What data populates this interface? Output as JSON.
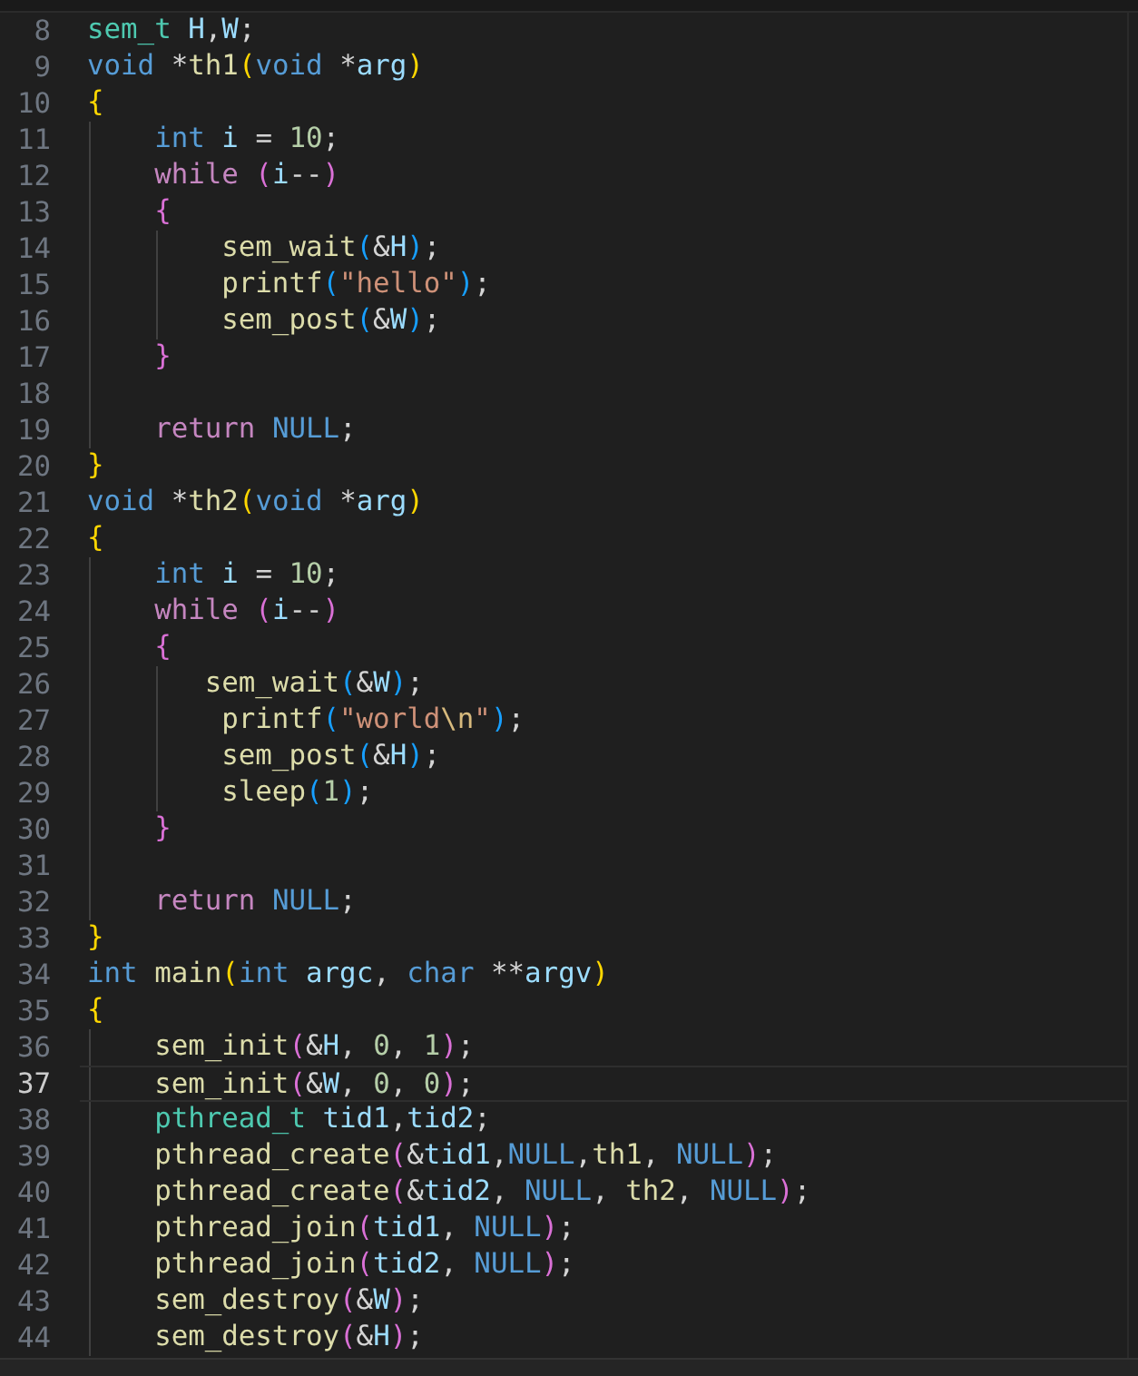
{
  "editor": {
    "lines": [
      {
        "number": "8",
        "active": false,
        "tokens": [
          {
            "text": "sem_t",
            "kind": "type"
          },
          {
            "text": " H",
            "kind": "var"
          },
          {
            "text": ",",
            "kind": "p"
          },
          {
            "text": "W",
            "kind": "var"
          },
          {
            "text": ";",
            "kind": "p"
          }
        ]
      },
      {
        "number": "9",
        "active": false,
        "tokens": [
          {
            "text": "void",
            "kind": "kw"
          },
          {
            "text": " *",
            "kind": "p"
          },
          {
            "text": "th1",
            "kind": "fn"
          },
          {
            "text": "(",
            "kind": "b1"
          },
          {
            "text": "void",
            "kind": "kw"
          },
          {
            "text": " *",
            "kind": "p"
          },
          {
            "text": "arg",
            "kind": "var"
          },
          {
            "text": ")",
            "kind": "b1"
          }
        ]
      },
      {
        "number": "10",
        "active": false,
        "tokens": [
          {
            "text": "{",
            "kind": "b1"
          }
        ]
      },
      {
        "number": "11",
        "active": false,
        "tokens": [
          {
            "text": "    int",
            "kind": "kw"
          },
          {
            "text": " i",
            "kind": "var"
          },
          {
            "text": " = ",
            "kind": "p"
          },
          {
            "text": "10",
            "kind": "num"
          },
          {
            "text": ";",
            "kind": "p"
          }
        ]
      },
      {
        "number": "12",
        "active": false,
        "tokens": [
          {
            "text": "    while",
            "kind": "ctl"
          },
          {
            "text": " (",
            "kind": "b2"
          },
          {
            "text": "i",
            "kind": "var"
          },
          {
            "text": "--",
            "kind": "p"
          },
          {
            "text": ")",
            "kind": "b2"
          }
        ]
      },
      {
        "number": "13",
        "active": false,
        "tokens": [
          {
            "text": "    {",
            "kind": "b2"
          }
        ]
      },
      {
        "number": "14",
        "active": false,
        "tokens": [
          {
            "text": "        sem_wait",
            "kind": "fn"
          },
          {
            "text": "(",
            "kind": "b3"
          },
          {
            "text": "&",
            "kind": "p"
          },
          {
            "text": "H",
            "kind": "var"
          },
          {
            "text": ")",
            "kind": "b3"
          },
          {
            "text": ";",
            "kind": "p"
          }
        ]
      },
      {
        "number": "15",
        "active": false,
        "tokens": [
          {
            "text": "        printf",
            "kind": "fn"
          },
          {
            "text": "(",
            "kind": "b3"
          },
          {
            "text": "\"hello\"",
            "kind": "str"
          },
          {
            "text": ")",
            "kind": "b3"
          },
          {
            "text": ";",
            "kind": "p"
          }
        ]
      },
      {
        "number": "16",
        "active": false,
        "tokens": [
          {
            "text": "        sem_post",
            "kind": "fn"
          },
          {
            "text": "(",
            "kind": "b3"
          },
          {
            "text": "&",
            "kind": "p"
          },
          {
            "text": "W",
            "kind": "var"
          },
          {
            "text": ")",
            "kind": "b3"
          },
          {
            "text": ";",
            "kind": "p"
          }
        ]
      },
      {
        "number": "17",
        "active": false,
        "tokens": [
          {
            "text": "    }",
            "kind": "b2"
          }
        ]
      },
      {
        "number": "18",
        "active": false
      },
      {
        "number": "19",
        "active": false,
        "tokens": [
          {
            "text": "    return",
            "kind": "ctl"
          },
          {
            "text": " NULL",
            "kind": "kw"
          },
          {
            "text": ";",
            "kind": "p"
          }
        ]
      },
      {
        "number": "20",
        "active": false,
        "tokens": [
          {
            "text": "}",
            "kind": "b1"
          }
        ]
      },
      {
        "number": "21",
        "active": false,
        "tokens": [
          {
            "text": "void",
            "kind": "kw"
          },
          {
            "text": " *",
            "kind": "p"
          },
          {
            "text": "th2",
            "kind": "fn"
          },
          {
            "text": "(",
            "kind": "b1"
          },
          {
            "text": "void",
            "kind": "kw"
          },
          {
            "text": " *",
            "kind": "p"
          },
          {
            "text": "arg",
            "kind": "var"
          },
          {
            "text": ")",
            "kind": "b1"
          }
        ]
      },
      {
        "number": "22",
        "active": false,
        "tokens": [
          {
            "text": "{",
            "kind": "b1"
          }
        ]
      },
      {
        "number": "23",
        "active": false,
        "tokens": [
          {
            "text": "    int",
            "kind": "kw"
          },
          {
            "text": " i",
            "kind": "var"
          },
          {
            "text": " = ",
            "kind": "p"
          },
          {
            "text": "10",
            "kind": "num"
          },
          {
            "text": ";",
            "kind": "p"
          }
        ]
      },
      {
        "number": "24",
        "active": false,
        "tokens": [
          {
            "text": "    while",
            "kind": "ctl"
          },
          {
            "text": " (",
            "kind": "b2"
          },
          {
            "text": "i",
            "kind": "var"
          },
          {
            "text": "--",
            "kind": "p"
          },
          {
            "text": ")",
            "kind": "b2"
          }
        ]
      },
      {
        "number": "25",
        "active": false,
        "tokens": [
          {
            "text": "    {",
            "kind": "b2"
          }
        ]
      },
      {
        "number": "26",
        "active": false,
        "tokens": [
          {
            "text": "       sem_wait",
            "kind": "fn"
          },
          {
            "text": "(",
            "kind": "b3"
          },
          {
            "text": "&",
            "kind": "p"
          },
          {
            "text": "W",
            "kind": "var"
          },
          {
            "text": ")",
            "kind": "b3"
          },
          {
            "text": ";",
            "kind": "p"
          }
        ]
      },
      {
        "number": "27",
        "active": false,
        "tokens": [
          {
            "text": "        printf",
            "kind": "fn"
          },
          {
            "text": "(",
            "kind": "b3"
          },
          {
            "text": "\"world",
            "kind": "str"
          },
          {
            "text": "\\n",
            "kind": "esc"
          },
          {
            "text": "\"",
            "kind": "str"
          },
          {
            "text": ")",
            "kind": "b3"
          },
          {
            "text": ";",
            "kind": "p"
          }
        ]
      },
      {
        "number": "28",
        "active": false,
        "tokens": [
          {
            "text": "        sem_post",
            "kind": "fn"
          },
          {
            "text": "(",
            "kind": "b3"
          },
          {
            "text": "&",
            "kind": "p"
          },
          {
            "text": "H",
            "kind": "var"
          },
          {
            "text": ")",
            "kind": "b3"
          },
          {
            "text": ";",
            "kind": "p"
          }
        ]
      },
      {
        "number": "29",
        "active": false,
        "tokens": [
          {
            "text": "        sleep",
            "kind": "fn"
          },
          {
            "text": "(",
            "kind": "b3"
          },
          {
            "text": "1",
            "kind": "num"
          },
          {
            "text": ")",
            "kind": "b3"
          },
          {
            "text": ";",
            "kind": "p"
          }
        ]
      },
      {
        "number": "30",
        "active": false,
        "tokens": [
          {
            "text": "    }",
            "kind": "b2"
          }
        ]
      },
      {
        "number": "31",
        "active": false
      },
      {
        "number": "32",
        "active": false,
        "tokens": [
          {
            "text": "    return",
            "kind": "ctl"
          },
          {
            "text": " NULL",
            "kind": "kw"
          },
          {
            "text": ";",
            "kind": "p"
          }
        ]
      },
      {
        "number": "33",
        "active": false,
        "tokens": [
          {
            "text": "}",
            "kind": "b1"
          }
        ]
      },
      {
        "number": "34",
        "active": false,
        "tokens": [
          {
            "text": "int",
            "kind": "kw"
          },
          {
            "text": " main",
            "kind": "fn"
          },
          {
            "text": "(",
            "kind": "b1"
          },
          {
            "text": "int",
            "kind": "kw"
          },
          {
            "text": " argc",
            "kind": "var"
          },
          {
            "text": ", ",
            "kind": "p"
          },
          {
            "text": "char",
            "kind": "kw"
          },
          {
            "text": " **",
            "kind": "p"
          },
          {
            "text": "argv",
            "kind": "var"
          },
          {
            "text": ")",
            "kind": "b1"
          }
        ]
      },
      {
        "number": "35",
        "active": false,
        "tokens": [
          {
            "text": "{",
            "kind": "b1"
          }
        ]
      },
      {
        "number": "36",
        "active": false,
        "tokens": [
          {
            "text": "    sem_init",
            "kind": "fn"
          },
          {
            "text": "(",
            "kind": "b2"
          },
          {
            "text": "&",
            "kind": "p"
          },
          {
            "text": "H",
            "kind": "var"
          },
          {
            "text": ", ",
            "kind": "p"
          },
          {
            "text": "0",
            "kind": "num"
          },
          {
            "text": ", ",
            "kind": "p"
          },
          {
            "text": "1",
            "kind": "num"
          },
          {
            "text": ")",
            "kind": "b2"
          },
          {
            "text": ";",
            "kind": "p"
          }
        ]
      },
      {
        "number": "37",
        "active": true,
        "tokens": [
          {
            "text": "    sem_init",
            "kind": "fn"
          },
          {
            "text": "(",
            "kind": "b2"
          },
          {
            "text": "&",
            "kind": "p"
          },
          {
            "text": "W",
            "kind": "var"
          },
          {
            "text": ", ",
            "kind": "p"
          },
          {
            "text": "0",
            "kind": "num"
          },
          {
            "text": ", ",
            "kind": "p"
          },
          {
            "text": "0",
            "kind": "num"
          },
          {
            "text": ")",
            "kind": "b2"
          },
          {
            "text": ";",
            "kind": "p"
          }
        ]
      },
      {
        "number": "38",
        "active": false,
        "tokens": [
          {
            "text": "    pthread_t",
            "kind": "type"
          },
          {
            "text": " tid1",
            "kind": "var"
          },
          {
            "text": ",",
            "kind": "p"
          },
          {
            "text": "tid2",
            "kind": "var"
          },
          {
            "text": ";",
            "kind": "p"
          }
        ]
      },
      {
        "number": "39",
        "active": false,
        "tokens": [
          {
            "text": "    pthread_create",
            "kind": "fn"
          },
          {
            "text": "(",
            "kind": "b2"
          },
          {
            "text": "&",
            "kind": "p"
          },
          {
            "text": "tid1",
            "kind": "var"
          },
          {
            "text": ",",
            "kind": "p"
          },
          {
            "text": "NULL",
            "kind": "kw"
          },
          {
            "text": ",",
            "kind": "p"
          },
          {
            "text": "th1",
            "kind": "fn"
          },
          {
            "text": ", ",
            "kind": "p"
          },
          {
            "text": "NULL",
            "kind": "kw"
          },
          {
            "text": ")",
            "kind": "b2"
          },
          {
            "text": ";",
            "kind": "p"
          }
        ]
      },
      {
        "number": "40",
        "active": false,
        "tokens": [
          {
            "text": "    pthread_create",
            "kind": "fn"
          },
          {
            "text": "(",
            "kind": "b2"
          },
          {
            "text": "&",
            "kind": "p"
          },
          {
            "text": "tid2",
            "kind": "var"
          },
          {
            "text": ", ",
            "kind": "p"
          },
          {
            "text": "NULL",
            "kind": "kw"
          },
          {
            "text": ", ",
            "kind": "p"
          },
          {
            "text": "th2",
            "kind": "fn"
          },
          {
            "text": ", ",
            "kind": "p"
          },
          {
            "text": "NULL",
            "kind": "kw"
          },
          {
            "text": ")",
            "kind": "b2"
          },
          {
            "text": ";",
            "kind": "p"
          }
        ]
      },
      {
        "number": "41",
        "active": false,
        "tokens": [
          {
            "text": "    pthread_join",
            "kind": "fn"
          },
          {
            "text": "(",
            "kind": "b2"
          },
          {
            "text": "tid1",
            "kind": "var"
          },
          {
            "text": ", ",
            "kind": "p"
          },
          {
            "text": "NULL",
            "kind": "kw"
          },
          {
            "text": ")",
            "kind": "b2"
          },
          {
            "text": ";",
            "kind": "p"
          }
        ]
      },
      {
        "number": "42",
        "active": false,
        "tokens": [
          {
            "text": "    pthread_join",
            "kind": "fn"
          },
          {
            "text": "(",
            "kind": "b2"
          },
          {
            "text": "tid2",
            "kind": "var"
          },
          {
            "text": ", ",
            "kind": "p"
          },
          {
            "text": "NULL",
            "kind": "kw"
          },
          {
            "text": ")",
            "kind": "b2"
          },
          {
            "text": ";",
            "kind": "p"
          }
        ]
      },
      {
        "number": "43",
        "active": false,
        "tokens": [
          {
            "text": "    sem_destroy",
            "kind": "fn"
          },
          {
            "text": "(",
            "kind": "b2"
          },
          {
            "text": "&",
            "kind": "p"
          },
          {
            "text": "W",
            "kind": "var"
          },
          {
            "text": ")",
            "kind": "b2"
          },
          {
            "text": ";",
            "kind": "p"
          }
        ]
      },
      {
        "number": "44",
        "active": false,
        "tokens": [
          {
            "text": "    sem_destroy",
            "kind": "fn"
          },
          {
            "text": "(",
            "kind": "b2"
          },
          {
            "text": "&",
            "kind": "p"
          },
          {
            "text": "H",
            "kind": "var"
          },
          {
            "text": ")",
            "kind": "b2"
          },
          {
            "text": ";",
            "kind": "p"
          }
        ]
      }
    ]
  }
}
